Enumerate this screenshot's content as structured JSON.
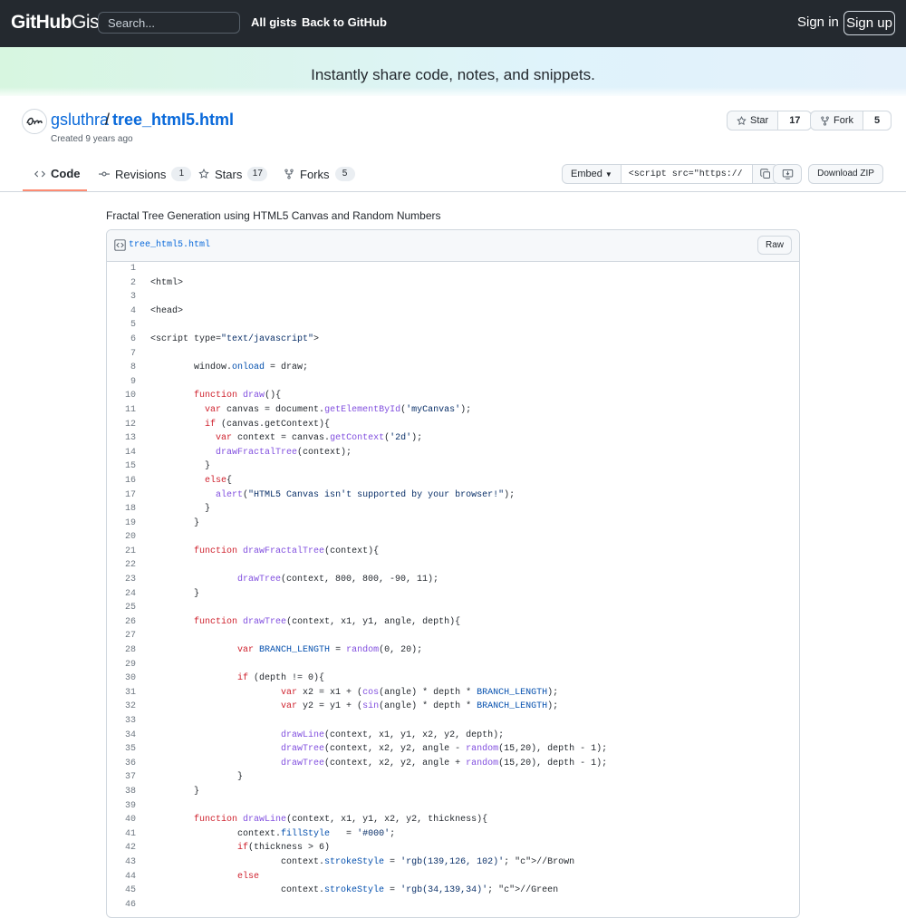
{
  "header": {
    "logo_main": "GitHub",
    "logo_sub": "Gist",
    "search_placeholder": "Search...",
    "nav": [
      "All gists",
      "Back to GitHub"
    ],
    "sign_in": "Sign in",
    "sign_up": "Sign up"
  },
  "banner": {
    "tagline": "Instantly share code, notes, and snippets."
  },
  "gist": {
    "owner": "gsluthra",
    "separator": "/",
    "title": "tree_html5.html",
    "created": "Created 9 years ago",
    "star_label": "Star",
    "star_count": "17",
    "fork_label": "Fork",
    "fork_count": "5"
  },
  "tabs": [
    {
      "label": "Code",
      "count": ""
    },
    {
      "label": "Revisions",
      "count": "1"
    },
    {
      "label": "Stars",
      "count": "17"
    },
    {
      "label": "Forks",
      "count": "5"
    }
  ],
  "toolbar": {
    "embed_label": "Embed",
    "embed_value": "<script src=\"https://",
    "download_label": "Download ZIP"
  },
  "description": "Fractal Tree Generation using HTML5 Canvas and Random Numbers",
  "file": {
    "name": "tree_html5.html",
    "raw_label": "Raw",
    "lines": [
      "",
      "<html>",
      "",
      "<head>",
      "",
      "<script type=\"text/javascript\">",
      "",
      "        window.onload = draw;",
      "",
      "        function draw(){",
      "          var canvas = document.getElementById('myCanvas');",
      "          if (canvas.getContext){",
      "            var context = canvas.getContext('2d');",
      "            drawFractalTree(context);",
      "          }",
      "          else{",
      "            alert(\"HTML5 Canvas isn't supported by your browser!\");",
      "          }",
      "        }",
      "",
      "        function drawFractalTree(context){",
      "",
      "                drawTree(context, 800, 800, -90, 11);",
      "        }",
      "",
      "        function drawTree(context, x1, y1, angle, depth){",
      "",
      "                var BRANCH_LENGTH = random(0, 20);",
      "",
      "                if (depth != 0){",
      "                        var x2 = x1 + (cos(angle) * depth * BRANCH_LENGTH);",
      "                        var y2 = y1 + (sin(angle) * depth * BRANCH_LENGTH);",
      "",
      "                        drawLine(context, x1, y1, x2, y2, depth);",
      "                        drawTree(context, x2, y2, angle - random(15,20), depth - 1);",
      "                        drawTree(context, x2, y2, angle + random(15,20), depth - 1);",
      "                }",
      "        }",
      "",
      "        function drawLine(context, x1, y1, x2, y2, thickness){",
      "                context.fillStyle   = '#000';",
      "                if(thickness > 6)",
      "                        context.strokeStyle = 'rgb(139,126, 102)'; //Brown",
      "                else",
      "                        context.strokeStyle = 'rgb(34,139,34)'; //Green",
      ""
    ]
  }
}
